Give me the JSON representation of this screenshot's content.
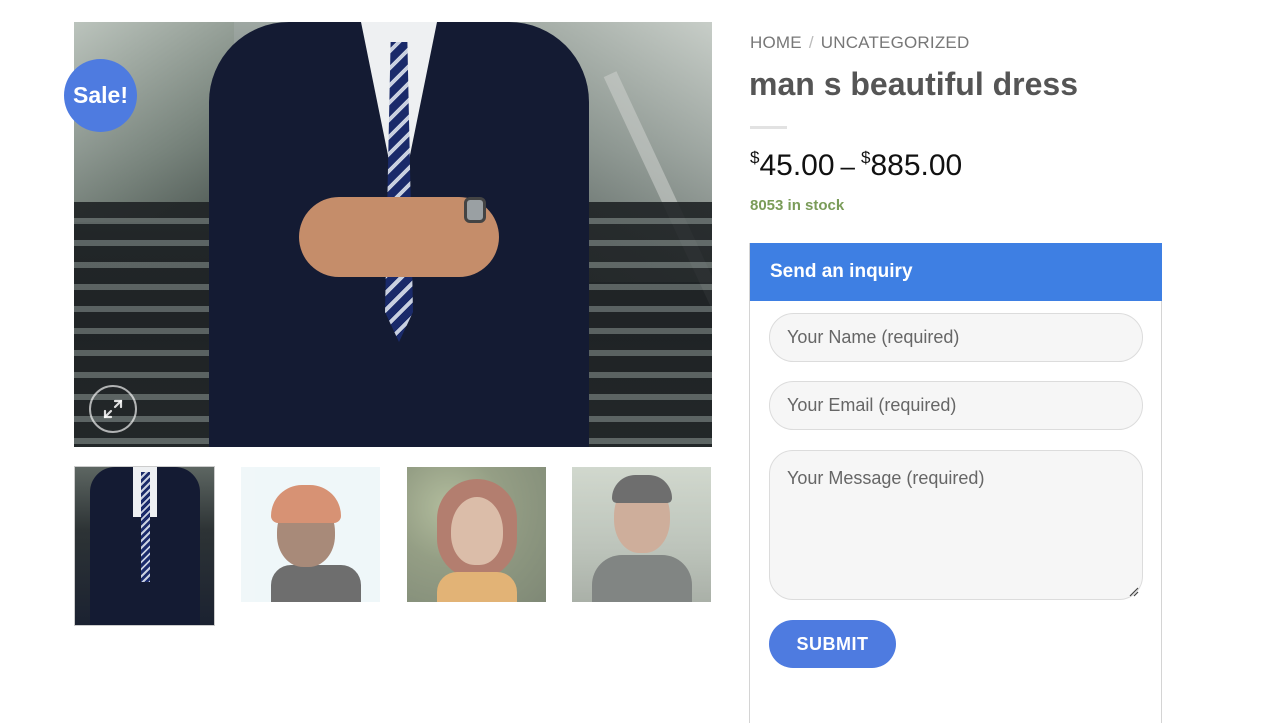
{
  "gallery": {
    "sale_badge": "Sale!",
    "zoom_icon": "expand-icon",
    "thumbnails": [
      {
        "name": "man-in-suit",
        "active": true
      },
      {
        "name": "man-orange-beanie",
        "active": false
      },
      {
        "name": "woman-red-hair",
        "active": false
      },
      {
        "name": "man-gray-sweater",
        "active": false
      }
    ]
  },
  "breadcrumb": {
    "home": "HOME",
    "separator": "/",
    "category": "UNCATEGORIZED"
  },
  "product": {
    "title": "man s beautiful dress",
    "price_currency": "$",
    "price_min": "45.00",
    "price_dash": "–",
    "price_max": "885.00",
    "stock": "8053 in stock"
  },
  "inquiry": {
    "header": "Send an inquiry",
    "name_placeholder": "Your Name (required)",
    "email_placeholder": "Your Email (required)",
    "message_placeholder": "Your Message (required)",
    "submit_label": "SUBMIT"
  },
  "colors": {
    "accent": "#4e7be0",
    "header_blue": "#3e7fe3",
    "stock_green": "#7a9c59"
  }
}
